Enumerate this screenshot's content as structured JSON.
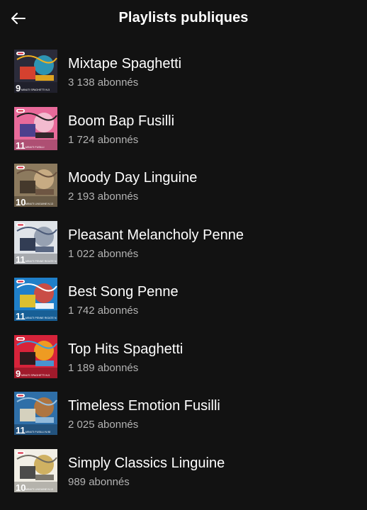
{
  "header": {
    "title": "Playlists publiques",
    "back_icon": "arrow-left-icon"
  },
  "playlists": [
    {
      "title": "Mixtape Spaghetti",
      "followers": "3 138 abonnés",
      "cover_number": "9",
      "cover_caption": "MINUTI SPAGHETTI N.5",
      "cover_colors": [
        "#2b2b3a",
        "#e8442f",
        "#2fa7c9",
        "#f2b01e"
      ]
    },
    {
      "title": "Boom Bap Fusilli",
      "followers": "1 724 abonnés",
      "cover_number": "11",
      "cover_caption": "MINUTI FUSILLI",
      "cover_colors": [
        "#e86a9a",
        "#3c3c8c",
        "#f4c9d8",
        "#1f1f1f"
      ]
    },
    {
      "title": "Moody Day Linguine",
      "followers": "2 193 abonnés",
      "cover_number": "10",
      "cover_caption": "MINUTI LINGUINE N.13",
      "cover_colors": [
        "#8c7a5e",
        "#3d3227",
        "#d1b48a",
        "#6a5240"
      ]
    },
    {
      "title": "Pleasant Melancholy Penne",
      "followers": "1 022 abonnés",
      "cover_number": "11",
      "cover_caption": "MINUTI PENNE RIGATE N.73",
      "cover_colors": [
        "#dfe3e8",
        "#1f2a44",
        "#8a95a8",
        "#4b5a78"
      ]
    },
    {
      "title": "Best Song Penne",
      "followers": "1 742 abonnés",
      "cover_number": "11",
      "cover_caption": "MINUTI PENNE RIGATE N.73",
      "cover_colors": [
        "#1f7fc9",
        "#f2c81e",
        "#e8442f",
        "#ffffff"
      ]
    },
    {
      "title": "Top Hits Spaghetti",
      "followers": "1 189 abonnés",
      "cover_number": "9",
      "cover_caption": "MINUTI SPAGHETTI N.5",
      "cover_colors": [
        "#d6233a",
        "#1a1a1a",
        "#f2b01e",
        "#3aa0e0"
      ]
    },
    {
      "title": "Timeless Emotion Fusilli",
      "followers": "2 025 abonnés",
      "cover_number": "11",
      "cover_caption": "MINUTI FUSILLI N.98",
      "cover_colors": [
        "#2f6fa8",
        "#e8dcc0",
        "#c4772f",
        "#9cc2e0"
      ]
    },
    {
      "title": "Simply Classics Linguine",
      "followers": "989 abonnés",
      "cover_number": "10",
      "cover_caption": "MINUTI LINGUINE N.13",
      "cover_colors": [
        "#f2efe6",
        "#3a3a3a",
        "#c9a64a",
        "#6f6a60"
      ]
    }
  ]
}
